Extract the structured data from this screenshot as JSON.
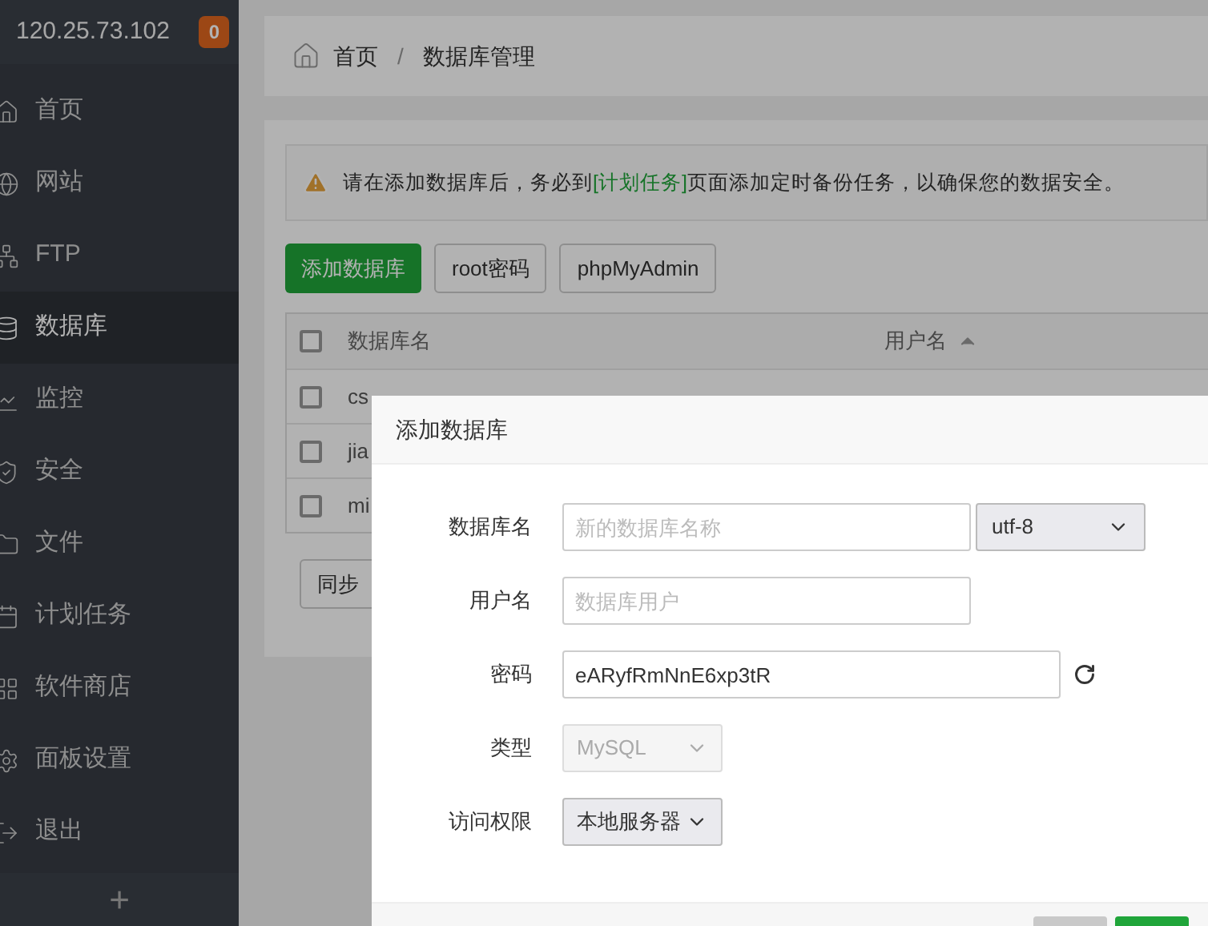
{
  "sidebar": {
    "server": "120.25.73.102",
    "badge": "0",
    "items": [
      {
        "label": "首页",
        "selected": false
      },
      {
        "label": "网站",
        "selected": false
      },
      {
        "label": "FTP",
        "selected": false
      },
      {
        "label": "数据库",
        "selected": true
      },
      {
        "label": "监控",
        "selected": false
      },
      {
        "label": "安全",
        "selected": false
      },
      {
        "label": "文件",
        "selected": false
      },
      {
        "label": "计划任务",
        "selected": false
      },
      {
        "label": "软件商店",
        "selected": false
      },
      {
        "label": "面板设置",
        "selected": false
      },
      {
        "label": "退出",
        "selected": false
      }
    ],
    "add": "+"
  },
  "breadcrumb": [
    "首页",
    "/",
    "数据库管理"
  ],
  "alert_link": "[计划任务]",
  "alert_before": "请在添加数据库后，务必到",
  "alert_after": "页面添加定时备份任务，以确保您的数据安全。",
  "toolbar": [
    {
      "label": "添加数据库",
      "kind": "primary"
    },
    {
      "label": "root密码",
      "kind": "default"
    },
    {
      "label": "phpMyAdmin",
      "kind": "default"
    }
  ],
  "table": {
    "select_all_checked": false,
    "columns": [
      "数据库名",
      "用户名"
    ],
    "rows": [
      {
        "checked": false,
        "name": "cs"
      },
      {
        "checked": false,
        "name": "jia"
      },
      {
        "checked": false,
        "name": "mi"
      }
    ]
  },
  "sync_button": "同步",
  "dialog": {
    "title": "添加数据库",
    "fields": [
      {
        "label": "数据库名",
        "kind": "input",
        "placeholder": "新的数据库名称",
        "select": "utf-8"
      },
      {
        "label": "用户名",
        "kind": "input",
        "placeholder": "数据库用户"
      },
      {
        "label": "密码",
        "kind": "password",
        "value": "eARyfRmNnE6xp3tR"
      },
      {
        "label": "类型",
        "kind": "select",
        "value": "MySQL",
        "disabled": true
      },
      {
        "label": "访问权限",
        "kind": "select",
        "value": "本地服务器",
        "disabled": false
      }
    ],
    "buttons": [
      {
        "kind": "default"
      },
      {
        "kind": "primary"
      }
    ]
  }
}
